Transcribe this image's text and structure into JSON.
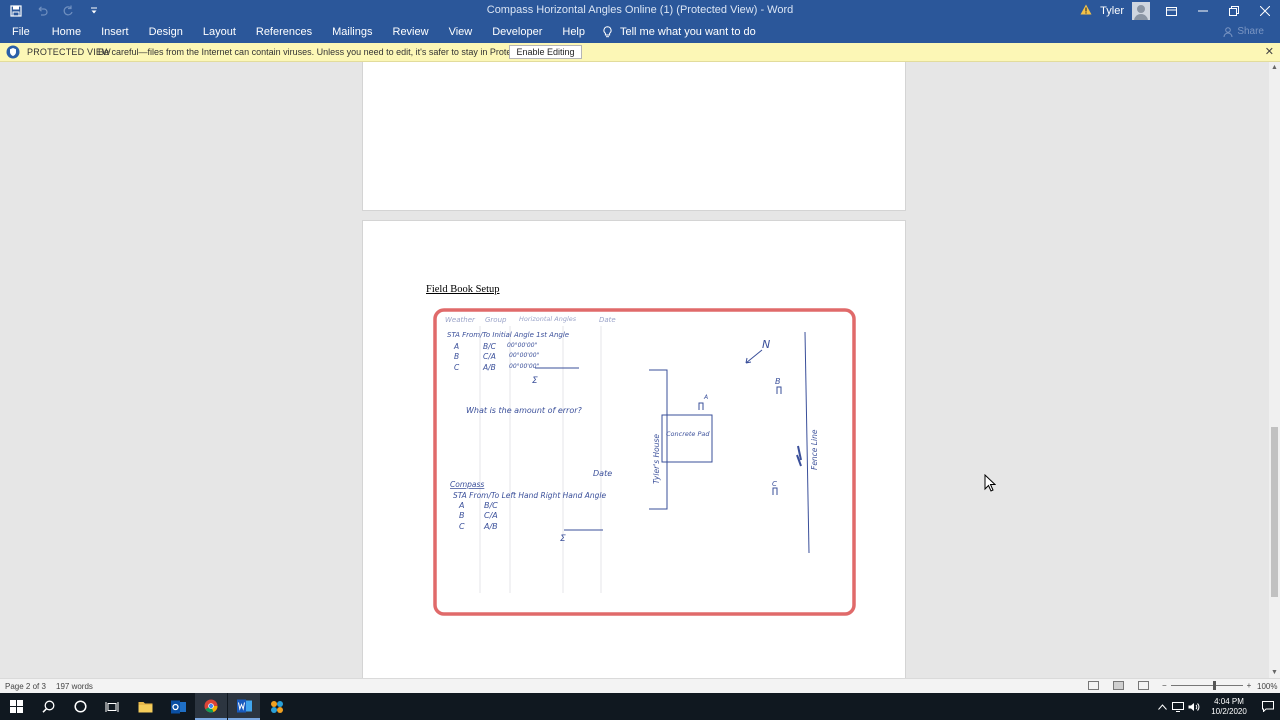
{
  "window": {
    "title": "Compass Horizontal Angles Online (1) (Protected View) - Word",
    "user": "Tyler"
  },
  "ribbon": {
    "tabs": [
      "File",
      "Home",
      "Insert",
      "Design",
      "Layout",
      "References",
      "Mailings",
      "Review",
      "View",
      "Developer",
      "Help"
    ],
    "tell_me": "Tell me what you want to do",
    "share": "Share"
  },
  "protected_view": {
    "label": "PROTECTED VIEW",
    "message": "Be careful—files from the Internet can contain viruses. Unless you need to edit, it's safer to stay in Protected View.",
    "button": "Enable Editing"
  },
  "document": {
    "heading": "Field Book Setup",
    "field_book": {
      "header_labels": [
        "Weather",
        "Group",
        "Horizontal Angles",
        "Date"
      ],
      "table1": {
        "header": "STA  From/To  Initial Angle  1st Angle",
        "rows": [
          {
            "sta": "A",
            "from_to": "B/C",
            "angle": "00°00'00\""
          },
          {
            "sta": "B",
            "from_to": "C/A",
            "angle": "00°00'00\""
          },
          {
            "sta": "C",
            "from_to": "A/B",
            "angle": "00°00'00\""
          }
        ],
        "sum": "Σ"
      },
      "question": "What is the amount of error?",
      "table2": {
        "title": "Compass",
        "date": "Date",
        "header": "STA  From/To  Left Hand  Right Hand  Angle",
        "rows": [
          {
            "sta": "A",
            "from_to": "B/C"
          },
          {
            "sta": "B",
            "from_to": "C/A"
          },
          {
            "sta": "C",
            "from_to": "A/B"
          }
        ],
        "sum": "Σ"
      },
      "sketch": {
        "north": "N",
        "house": "Tyler's House",
        "pad": "Concrete Pad",
        "fence": "Fence Line",
        "stations": [
          "A",
          "B",
          "C"
        ]
      }
    }
  },
  "status": {
    "page": "Page 2 of 3",
    "words": "197 words",
    "zoom": "100%",
    "zoom_level": 1.0
  },
  "taskbar": {
    "time": "4:04 PM",
    "date": "10/2/2020"
  },
  "colors": {
    "word_blue": "#2b579a",
    "protected_yellow": "#fcf7b6",
    "notebook_red": "#e06a6a",
    "ink_blue": "#3a4f9a"
  }
}
